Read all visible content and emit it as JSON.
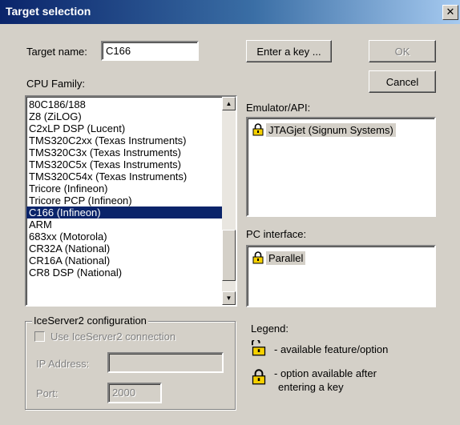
{
  "window": {
    "title": "Target selection",
    "close_glyph": "✕"
  },
  "target": {
    "label": "Target name:",
    "value": "C166"
  },
  "buttons": {
    "enter_key": "Enter a key ...",
    "ok": "OK",
    "cancel": "Cancel"
  },
  "cpu_family": {
    "label": "CPU Family:",
    "items": [
      "80C186/188",
      "Z8 (ZiLOG)",
      "C2xLP DSP (Lucent)",
      "TMS320C2xx (Texas Instruments)",
      "TMS320C3x (Texas Instruments)",
      "TMS320C5x (Texas Instruments)",
      "TMS320C54x (Texas Instruments)",
      "Tricore (Infineon)",
      "Tricore PCP (Infineon)",
      "C166 (Infineon)",
      "ARM",
      "683xx (Motorola)",
      "CR32A (National)",
      "CR16A (National)",
      "CR8 DSP (National)"
    ],
    "selected_index": 9
  },
  "emulator": {
    "label": "Emulator/API:",
    "items": [
      "JTAGjet (Signum Systems)"
    ]
  },
  "pc_interface": {
    "label": "PC interface:",
    "items": [
      "Parallel"
    ]
  },
  "iceserver": {
    "title": "IceServer2 configuration",
    "use_label": "Use IceServer2 connection",
    "ip_label": "IP Address:",
    "ip_value": "",
    "port_label": "Port:",
    "port_value": "2000"
  },
  "legend": {
    "title": "Legend:",
    "available": "- available feature/option",
    "after_key_line1": "- option available after",
    "after_key_line2": "entering a key"
  },
  "colors": {
    "selection": "#0a246a",
    "lock_gold": "#f5d000",
    "face": "#d4d0c8"
  }
}
